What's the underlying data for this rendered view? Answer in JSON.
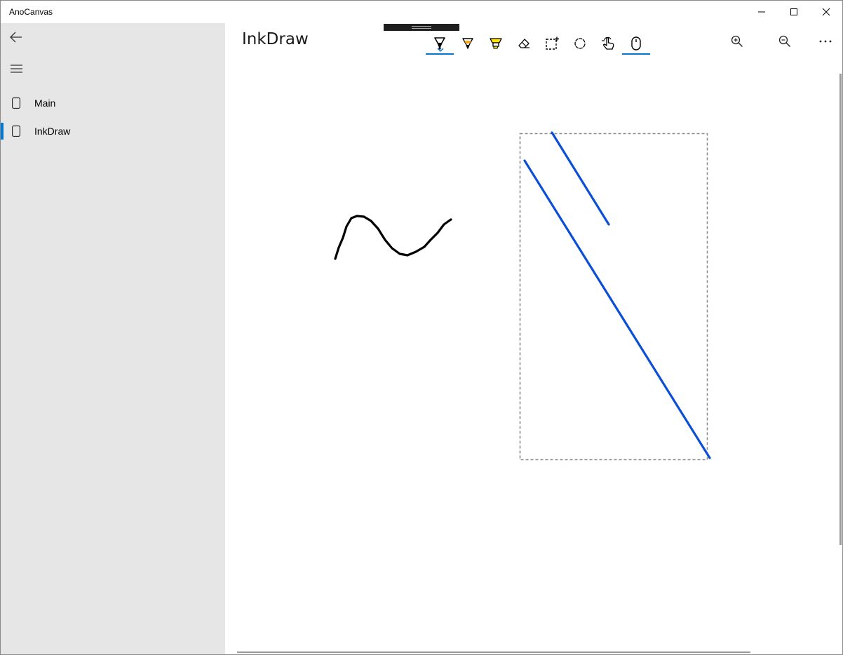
{
  "window": {
    "title": "AnoCanvas"
  },
  "titlebar": {
    "minimize_icon": "minimize-icon",
    "maximize_icon": "maximize-icon",
    "close_icon": "close-icon"
  },
  "sidebar": {
    "back_icon": "back-arrow-icon",
    "menu_icon": "hamburger-menu-icon",
    "items": [
      {
        "label": "Main",
        "icon": "page-icon",
        "selected": false
      },
      {
        "label": "InkDraw",
        "icon": "page-icon",
        "selected": true
      }
    ]
  },
  "header": {
    "title": "InkDraw"
  },
  "ink_toolbar": {
    "tools": [
      {
        "name": "ballpoint-pen",
        "icon": "ballpoint-pen-icon",
        "selected": true
      },
      {
        "name": "pencil",
        "icon": "pencil-icon",
        "selected": false
      },
      {
        "name": "highlighter",
        "icon": "highlighter-icon",
        "selected": false
      },
      {
        "name": "eraser",
        "icon": "eraser-icon",
        "selected": false
      },
      {
        "name": "lasso-select",
        "icon": "lasso-select-icon",
        "selected": false
      },
      {
        "name": "circle-stencil",
        "icon": "circle-icon",
        "selected": false
      },
      {
        "name": "touch-writing",
        "icon": "touch-writing-icon",
        "selected": false
      },
      {
        "name": "mouse-input",
        "icon": "mouse-icon",
        "selected": true
      }
    ]
  },
  "commands": {
    "zoom_in_icon": "zoom-in-icon",
    "zoom_out_icon": "zoom-out-icon",
    "more_icon": "more-icon"
  },
  "colors": {
    "accent": "#0078d7",
    "sidebar_bg": "#e6e6e6",
    "black_stroke": "#000000",
    "blue_stroke": "#0a4fd6",
    "selection_border": "#8a8a8a"
  }
}
